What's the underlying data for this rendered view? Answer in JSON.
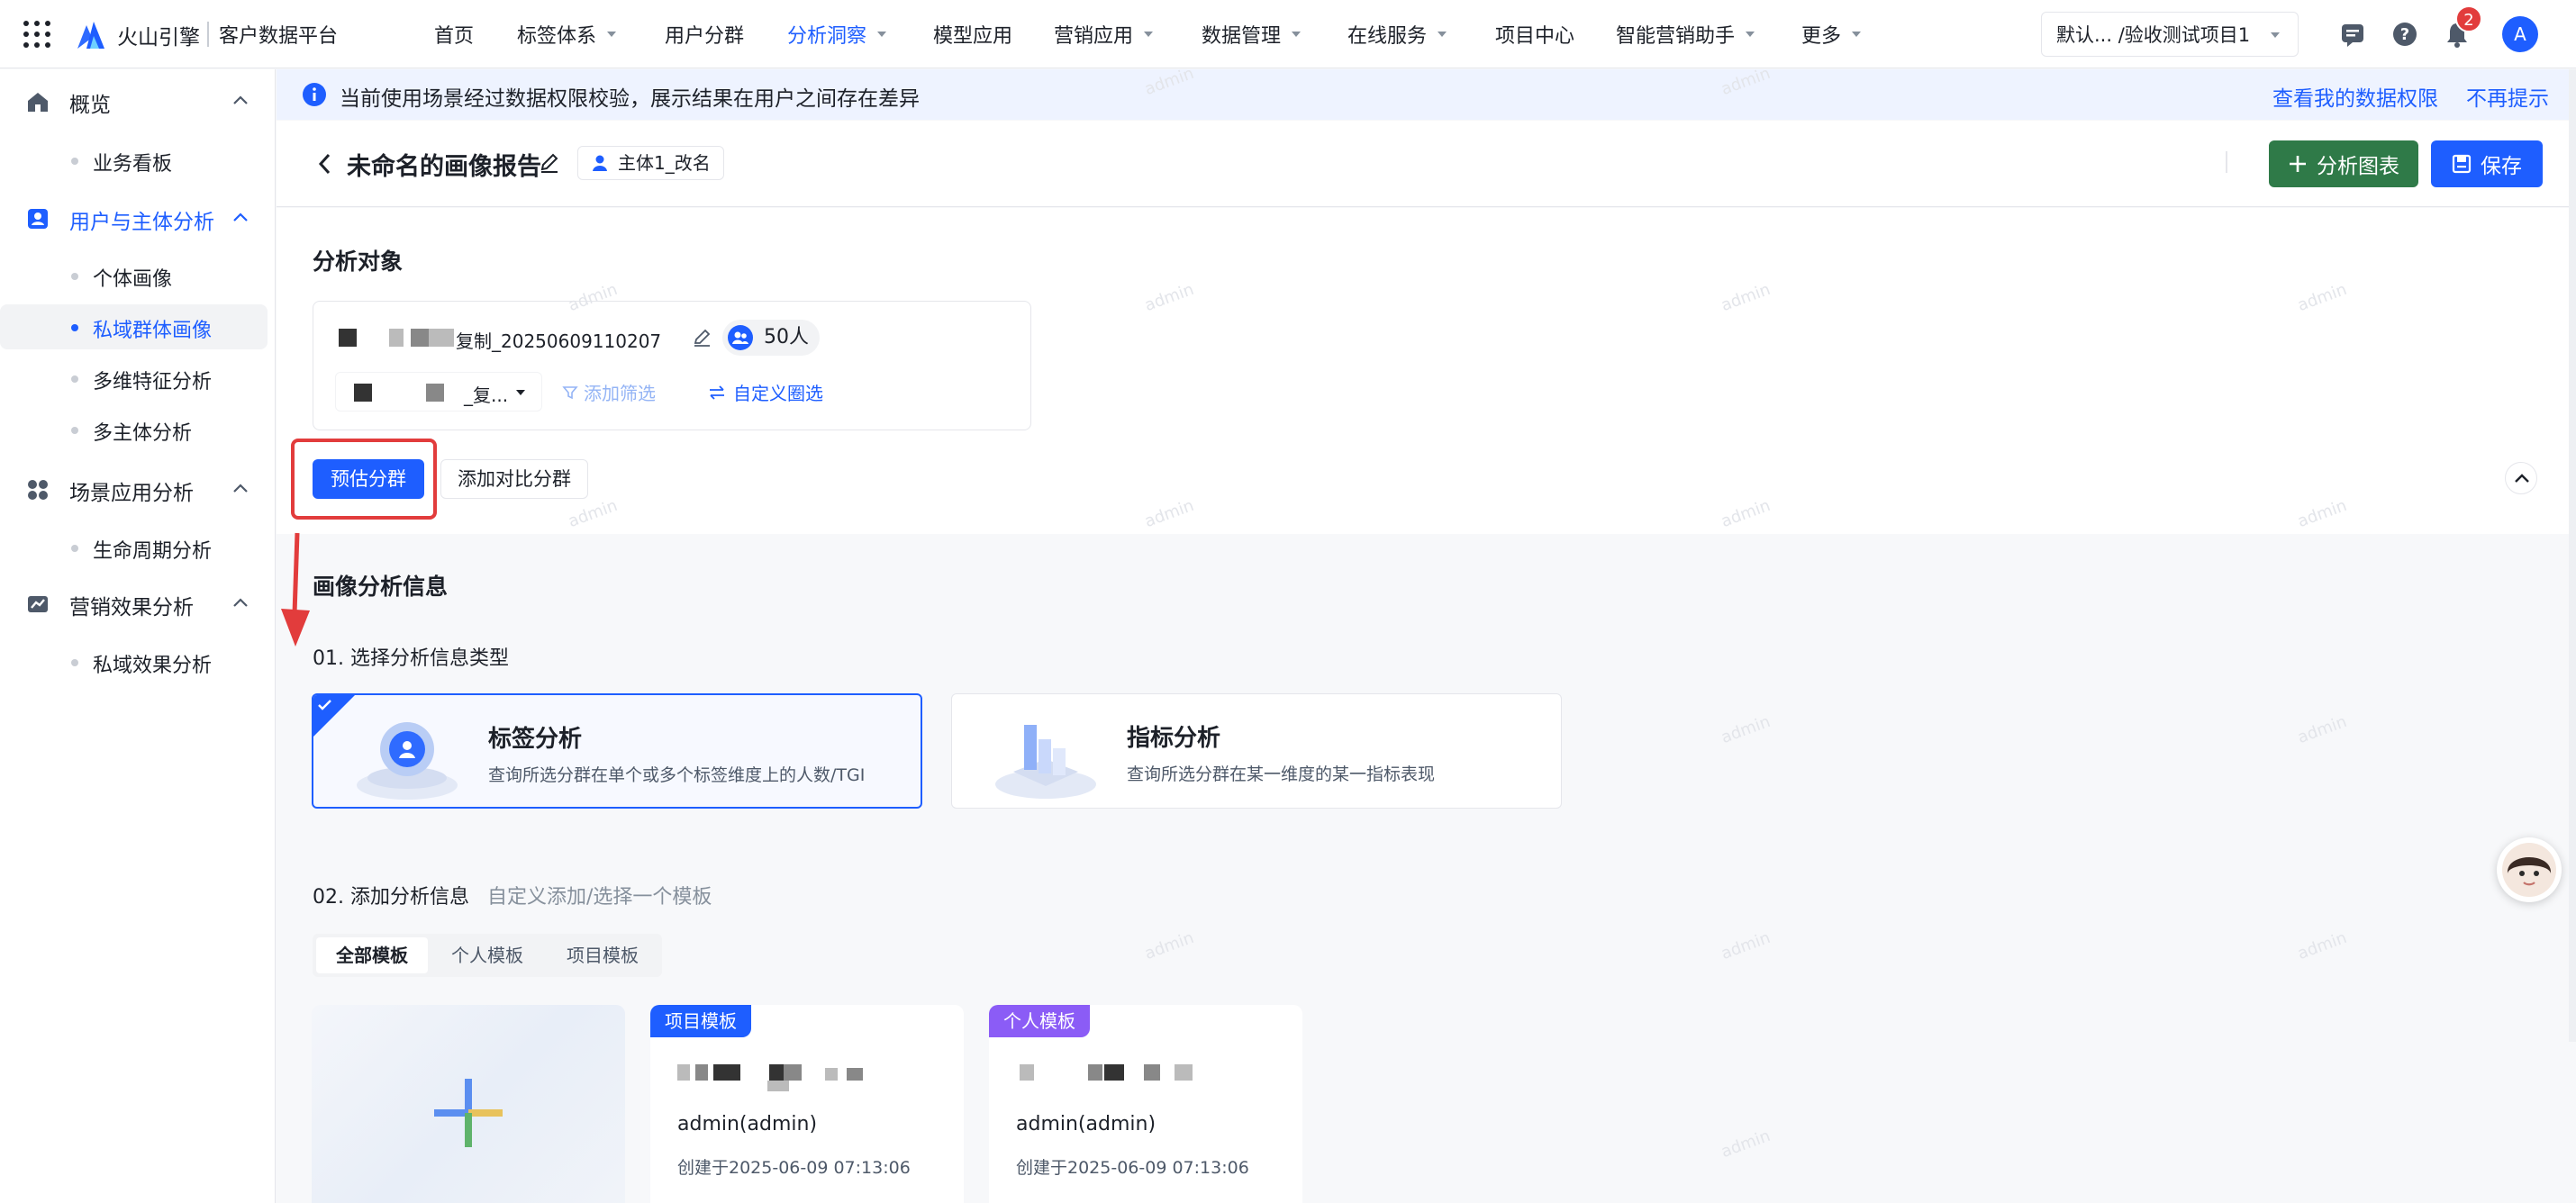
{
  "topbar": {
    "brand": "火山引擎",
    "product": "客户数据平台",
    "nav": [
      {
        "label": "首页"
      },
      {
        "label": "标签体系"
      },
      {
        "label": "用户分群"
      },
      {
        "label": "分析洞察"
      },
      {
        "label": "模型应用"
      },
      {
        "label": "营销应用"
      },
      {
        "label": "数据管理"
      },
      {
        "label": "在线服务"
      },
      {
        "label": "项目中心"
      },
      {
        "label": "智能营销助手"
      },
      {
        "label": "更多"
      }
    ],
    "project_selector": "默认...  /验收测试项目1",
    "notification_count": "2",
    "avatar_letter": "A",
    "accent_color": "#1e5eff"
  },
  "sidebar": {
    "sections": [
      {
        "label": "概览",
        "icon": "home-icon",
        "items": [
          {
            "label": "业务看板"
          }
        ]
      },
      {
        "label": "用户与主体分析",
        "icon": "user-card-icon",
        "items": [
          {
            "label": "个体画像"
          },
          {
            "label": "私域群体画像"
          },
          {
            "label": "多维特征分析"
          },
          {
            "label": "多主体分析"
          }
        ]
      },
      {
        "label": "场景应用分析",
        "icon": "apps-icon",
        "items": [
          {
            "label": "生命周期分析"
          }
        ]
      },
      {
        "label": "营销效果分析",
        "icon": "trend-chart-icon",
        "items": [
          {
            "label": "私域效果分析"
          }
        ]
      }
    ],
    "active_item": "私域群体画像"
  },
  "banner": {
    "text": "当前使用场景经过数据权限校验，展示结果在用户之间存在差异",
    "link_permissions": "查看我的数据权限",
    "link_dismiss": "不再提示"
  },
  "header": {
    "title": "未命名的画像报告",
    "subject": "主体1_改名",
    "analyze_chart_label": "分析图表",
    "save_label": "保存"
  },
  "analysis_object": {
    "heading": "分析对象",
    "segment_name": "复制_20250609110207",
    "segment_count": "50人",
    "selector_text": "_复...",
    "add_filter": "添加筛选",
    "custom_select": "自定义圈选",
    "estimate_button": "预估分群",
    "compare_button": "添加对比分群"
  },
  "portrait": {
    "heading": "画像分析信息",
    "step1": "01. 选择分析信息类型",
    "types": [
      {
        "title": "标签分析",
        "desc": "查询所选分群在单个或多个标签维度上的人数/TGI",
        "selected": true
      },
      {
        "title": "指标分析",
        "desc": "查询所选分群在某一维度的某一指标表现",
        "selected": false
      }
    ],
    "step2": "02. 添加分析信息",
    "step2_hint": "自定义添加/选择一个模板",
    "tabs": [
      "全部模板",
      "个人模板",
      "项目模板"
    ],
    "active_tab": "全部模板",
    "templates": [
      {
        "tag": "项目模板",
        "tag_color": "#1e5eff",
        "owner": "admin(admin)",
        "created": "创建于2025-06-09 07:13:06"
      },
      {
        "tag": "个人模板",
        "tag_color": "#8b5cf6",
        "owner": "admin(admin)",
        "created": "创建于2025-06-09 07:13:06"
      }
    ]
  },
  "watermark": "admin"
}
